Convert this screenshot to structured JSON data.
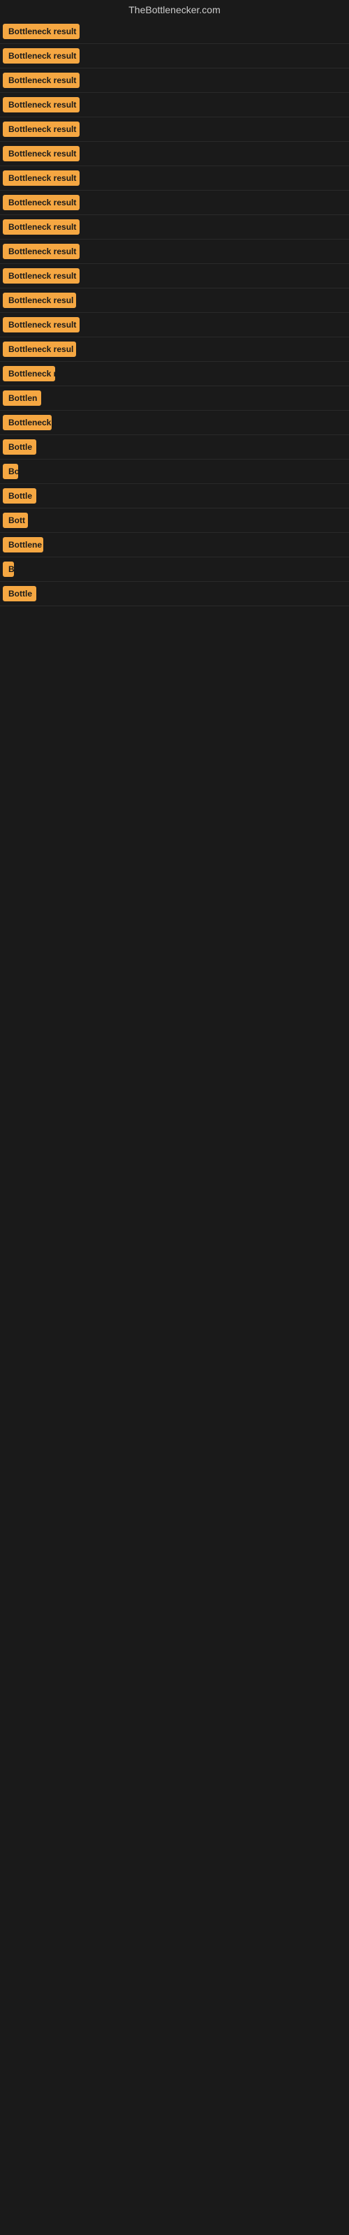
{
  "site": {
    "title": "TheBottlenecker.com"
  },
  "accent_color": "#f5a742",
  "results": [
    {
      "label": "Bottleneck result",
      "width": 110
    },
    {
      "label": "Bottleneck result",
      "width": 110
    },
    {
      "label": "Bottleneck result",
      "width": 110
    },
    {
      "label": "Bottleneck result",
      "width": 110
    },
    {
      "label": "Bottleneck result",
      "width": 110
    },
    {
      "label": "Bottleneck result",
      "width": 110
    },
    {
      "label": "Bottleneck result",
      "width": 110
    },
    {
      "label": "Bottleneck result",
      "width": 110
    },
    {
      "label": "Bottleneck result",
      "width": 110
    },
    {
      "label": "Bottleneck result",
      "width": 110
    },
    {
      "label": "Bottleneck result",
      "width": 110
    },
    {
      "label": "Bottleneck resul",
      "width": 105
    },
    {
      "label": "Bottleneck result",
      "width": 110
    },
    {
      "label": "Bottleneck resul",
      "width": 105
    },
    {
      "label": "Bottleneck r",
      "width": 75
    },
    {
      "label": "Bottlen",
      "width": 55
    },
    {
      "label": "Bottleneck",
      "width": 70
    },
    {
      "label": "Bottle",
      "width": 48
    },
    {
      "label": "Bo",
      "width": 22
    },
    {
      "label": "Bottle",
      "width": 48
    },
    {
      "label": "Bott",
      "width": 36
    },
    {
      "label": "Bottlene",
      "width": 58
    },
    {
      "label": "B",
      "width": 14
    },
    {
      "label": "Bottle",
      "width": 48
    }
  ]
}
